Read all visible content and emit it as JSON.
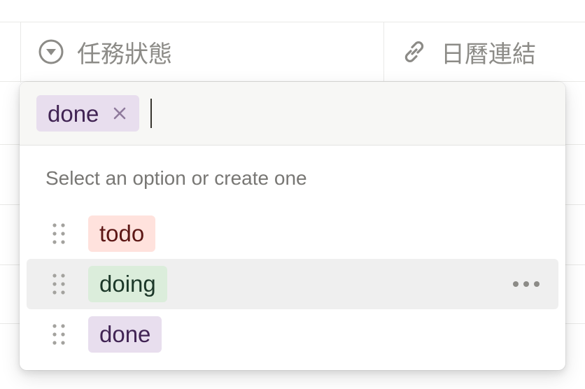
{
  "table": {
    "columns": [
      {
        "label": "任務狀態",
        "icon": "select-icon"
      },
      {
        "label": "日曆連結",
        "icon": "link-icon"
      }
    ]
  },
  "popup": {
    "selected": [
      {
        "label": "done",
        "color": "#e8deee",
        "text_color": "#412454"
      }
    ],
    "hint": "Select an option or create one",
    "options": [
      {
        "label": "todo",
        "color": "#ffe2dd",
        "text_color": "#5d1715"
      },
      {
        "label": "doing",
        "color": "#dbeddb",
        "text_color": "#1c3829",
        "hovered": true
      },
      {
        "label": "done",
        "color": "#e8deee",
        "text_color": "#412454"
      }
    ],
    "icons": {
      "remove": "close-icon",
      "drag": "drag-handle-icon",
      "more": "more-horizontal-icon"
    }
  }
}
